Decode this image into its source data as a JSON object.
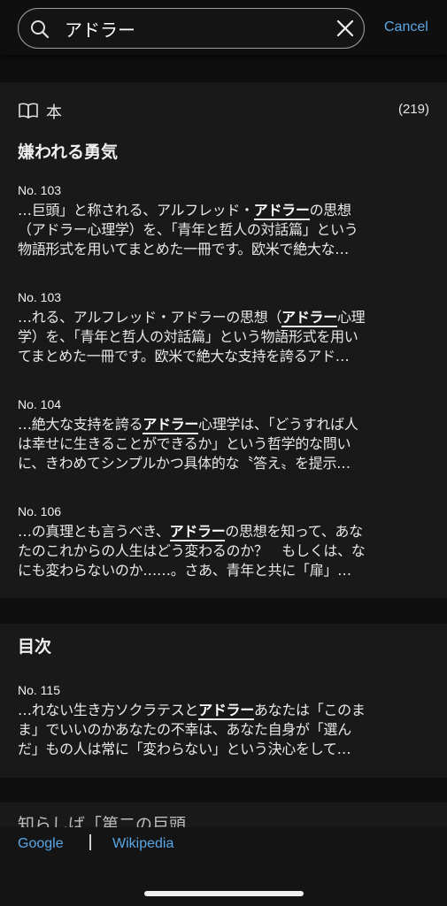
{
  "search": {
    "query": "アドラー",
    "cancel_label": "Cancel"
  },
  "books_section": {
    "label": "本",
    "count": "(219)",
    "book_title": "嫌われる勇気",
    "snippets": [
      {
        "location": "No. 103",
        "lines": [
          [
            {
              "t": "…巨頭」と称される、アルフレッド・",
              "h": false
            },
            {
              "t": "アドラー",
              "h": true
            },
            {
              "t": "の思想",
              "h": false
            }
          ],
          [
            {
              "t": "（アドラー心理学）を、「青年と哲人の対話篇」という",
              "h": false
            }
          ],
          [
            {
              "t": "物語形式を用いてまとめた一冊です。欧米で絶大な…",
              "h": false
            }
          ]
        ]
      },
      {
        "location": "No. 103",
        "lines": [
          [
            {
              "t": "…れる、アルフレッド・アドラーの思想（",
              "h": false
            },
            {
              "t": "アドラー",
              "h": true
            },
            {
              "t": "心理",
              "h": false
            }
          ],
          [
            {
              "t": "学）を、「青年と哲人の対話篇」という物語形式を用い",
              "h": false
            }
          ],
          [
            {
              "t": "てまとめた一冊です。欧米で絶大な支持を誇るアド…",
              "h": false
            }
          ]
        ]
      },
      {
        "location": "No. 104",
        "lines": [
          [
            {
              "t": "…絶大な支持を誇る",
              "h": false
            },
            {
              "t": "アドラー",
              "h": true
            },
            {
              "t": "心理学は、「どうすれば人",
              "h": false
            }
          ],
          [
            {
              "t": "は幸せに生きることができるか」という哲学的な問い",
              "h": false
            }
          ],
          [
            {
              "t": "に、きわめてシンプルかつ具体的な〝答え〟を提示…",
              "h": false
            }
          ]
        ]
      },
      {
        "location": "No. 106",
        "lines": [
          [
            {
              "t": "…の真理とも言うべき、",
              "h": false
            },
            {
              "t": "アドラー",
              "h": true
            },
            {
              "t": "の思想を知って、あな",
              "h": false
            }
          ],
          [
            {
              "t": "たのこれからの人生はどう変わるのか？　もしくは、な",
              "h": false
            }
          ],
          [
            {
              "t": "にも変わらないのか……。さあ、青年と共に「扉」…",
              "h": false
            }
          ]
        ]
      }
    ]
  },
  "toc_section": {
    "title": "目次",
    "snippets": [
      {
        "location": "No. 115",
        "lines": [
          [
            {
              "t": "…れない生き方ソクラテスと",
              "h": false
            },
            {
              "t": "アドラー",
              "h": true
            },
            {
              "t": "あなたは「このま",
              "h": false
            }
          ],
          [
            {
              "t": "ま」でいいのかあなたの不幸は、あなた自身が「選ん",
              "h": false
            }
          ],
          [
            {
              "t": "だ」もの人は常に「変わらない」という決心をして…",
              "h": false
            }
          ]
        ]
      }
    ]
  },
  "peek_section": {
    "text": "知らしば「第二の巨頭"
  },
  "footer": {
    "google_label": "Google",
    "wikipedia_label": "Wikipedia"
  },
  "colors": {
    "accent": "#5aa7e6",
    "background": "#0f0f0f",
    "panel": "#191919"
  },
  "icons": [
    "search-icon",
    "clear-icon",
    "book-icon"
  ]
}
